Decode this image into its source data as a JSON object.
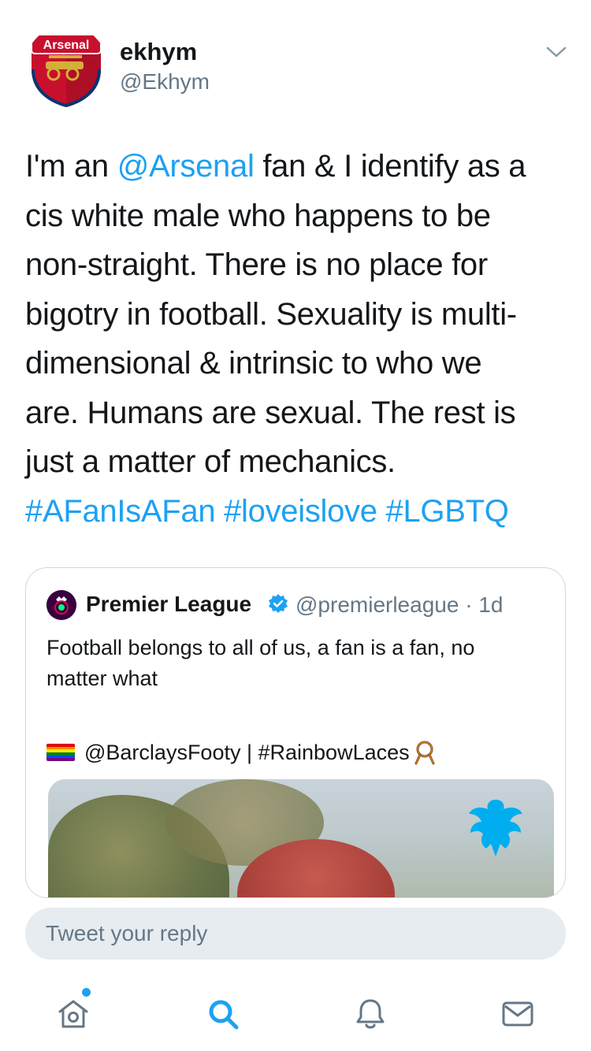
{
  "tweet": {
    "author_name": "ekhym",
    "author_handle": "@Ekhym",
    "avatar_text": "Arsenal",
    "lines": [
      [
        {
          "t": "I'm an "
        },
        {
          "t": "@Arsenal",
          "link": true
        },
        {
          "t": " fan & I identify as a"
        }
      ],
      [
        {
          "t": "cis white male who happens to be"
        }
      ],
      [
        {
          "t": "non-straight. There is no place for"
        }
      ],
      [
        {
          "t": "bigotry in football. Sexuality is multi-"
        }
      ],
      [
        {
          "t": "dimensional & intrinsic to who we"
        }
      ],
      [
        {
          "t": "are. Humans are sexual. The rest is"
        }
      ],
      [
        {
          "t": "just a matter of mechanics."
        }
      ],
      [
        {
          "t": "#AFanIsAFan",
          "link": true
        },
        {
          "t": " "
        },
        {
          "t": "#loveislove",
          "link": true
        },
        {
          "t": " "
        },
        {
          "t": "#LGBTQ",
          "link": true
        }
      ]
    ]
  },
  "quote": {
    "name": "Premier League",
    "handle_time": "@premierleague · 1d",
    "text_lines": [
      "Football belongs to all of us, a fan is a fan, no",
      "matter what"
    ],
    "mention": "@BarclaysFooty",
    "separator": " | ",
    "hashtag": "#RainbowLaces"
  },
  "reply": {
    "placeholder": "Tweet your reply"
  },
  "tabs": [
    "home-icon",
    "search-icon",
    "notifications-icon",
    "messages-icon"
  ],
  "colors": {
    "accent": "#1da1f2",
    "text": "#14171a",
    "secondary": "#657786",
    "reply_bg": "#e6ecf0",
    "arsenal_red": "#c8102e",
    "premier_league_purple": "#38003c"
  }
}
